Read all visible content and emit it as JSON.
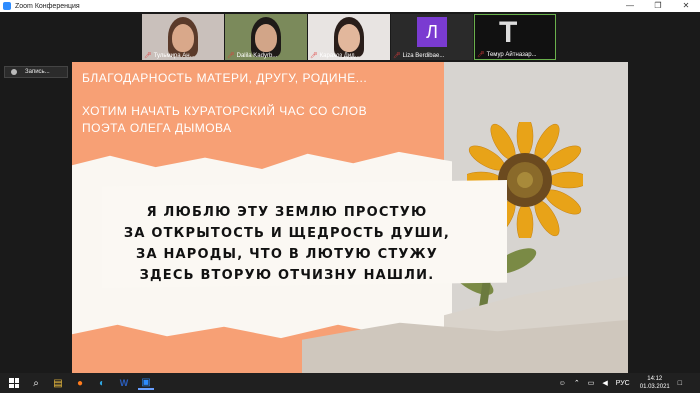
{
  "window": {
    "title": "Zoom Конференция",
    "controls": [
      "—",
      "❐",
      "✕"
    ]
  },
  "participants": [
    {
      "name": "Тульмира Ан..."
    },
    {
      "name": "Dalila Kadyrb..."
    },
    {
      "name": "Карахоз Дид..."
    },
    {
      "name": "Liza Berdibae...",
      "avatar_letter": "Л"
    },
    {
      "name": "Темур Айтназар..."
    }
  ],
  "recording": {
    "label": "Запись..."
  },
  "slide": {
    "heading_line1": "БЛАГОДАРНОСТЬ МАТЕРИ, ДРУГУ, РОДИНЕ...",
    "heading_line2": "ХОТИМ  НАЧАТЬ КУРАТОРСКИЙ ЧАС СО СЛОВ ПОЭТА ОЛЕГА ДЫМОВА",
    "poem": [
      "Я ЛЮБЛЮ ЭТУ ЗЕМЛЮ ПРОСТУЮ",
      "ЗА ОТКРЫТОСТЬ И ЩЕДРОСТЬ ДУШИ,",
      "ЗА НАРОДЫ, ЧТО В ЛЮТУЮ СТУЖУ",
      "ЗДЕСЬ ВТОРУЮ ОТЧИЗНУ НАШЛИ."
    ]
  },
  "taskbar": {
    "icons": [
      "windows-start-icon",
      "search-icon",
      "file-explorer-icon",
      "firefox-icon",
      "edge-icon",
      "word-icon",
      "zoom-icon"
    ],
    "language": "РУС",
    "time": "14:12",
    "date": "01.03.2021"
  },
  "colors": {
    "slide_orange": "#f7a075",
    "zoom_blue": "#2d8cff"
  }
}
